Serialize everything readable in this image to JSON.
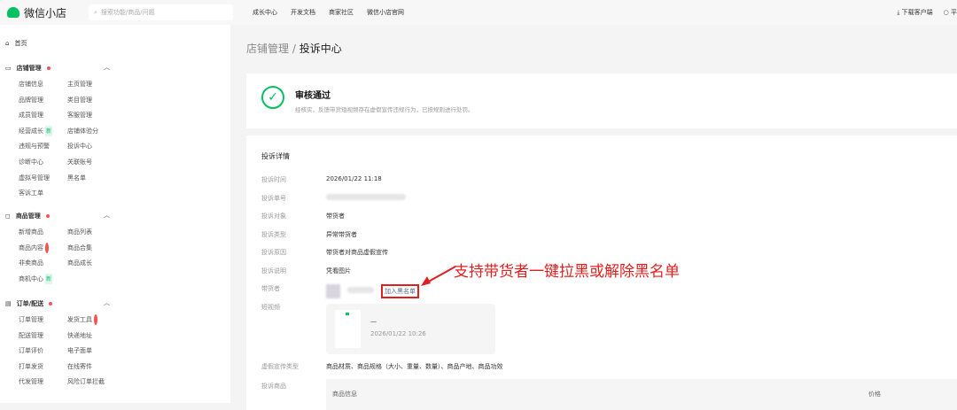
{
  "topbar": {
    "app_name": "微信小店",
    "search_placeholder": "搜索功能/商品/问题",
    "nav": [
      "成长中心",
      "开发文档",
      "商家社区",
      "微信小店官网"
    ],
    "download": "下载客户端",
    "platform": "平"
  },
  "sidebar": {
    "home": "首页",
    "groups": [
      {
        "title": "店铺管理",
        "items": [
          "店铺信息",
          "主页管理",
          "品牌管理",
          "类目管理",
          "成员管理",
          "客服管理",
          "经营成长",
          "店铺体验分",
          "违规与预警",
          "投诉中心",
          "诊断中心",
          "关联账号",
          "虚拟号管理",
          "黑名单",
          "客诉工单"
        ]
      },
      {
        "title": "商品管理",
        "items": [
          "新增商品",
          "商品列表",
          "商品内容",
          "商品合集",
          "非卖商品",
          "商品成长",
          "商机中心"
        ]
      },
      {
        "title": "订单/配送",
        "items": [
          "订单管理",
          "发货工具",
          "配送管理",
          "快递地址",
          "订单评价",
          "电子面单",
          "打单发货",
          "在线寄件",
          "代发管理",
          "风险订单拦截"
        ]
      }
    ],
    "new_badge": "新"
  },
  "breadcrumb": {
    "parent": "店铺管理",
    "sep": " / ",
    "current": "投诉中心"
  },
  "status": {
    "title": "审核通过",
    "desc": "经核实，反馈带货短视频存在虚假宣传违规行为，已按规则进行处罚。"
  },
  "detail": {
    "title": "投诉详情",
    "rows": [
      {
        "k": "投诉时间",
        "v": "2026/01/22 11:18"
      },
      {
        "k": "投诉单号",
        "v": ""
      },
      {
        "k": "投诉对象",
        "v": "带货者"
      },
      {
        "k": "投诉类型",
        "v": "异常带货者"
      },
      {
        "k": "投诉原因",
        "v": "带货者对商品虚假宣传"
      },
      {
        "k": "投诉说明",
        "v": "凭看图片"
      },
      {
        "k": "带货者",
        "v": ""
      },
      {
        "k": "短视频",
        "v": ""
      }
    ],
    "blacklist_link": "加入黑名单",
    "video_title": "—",
    "video_time": "2026/01/22 10:26",
    "false_type_label": "虚假宣传类型",
    "false_type_value": "商品材质、商品规格（大小、重量、数量）、商品产地、商品功效",
    "goods_label": "投诉商品",
    "col_info": "商品信息",
    "col_price": "价格"
  },
  "annotation": "支持带货者一键拉黑或解除黑名单"
}
